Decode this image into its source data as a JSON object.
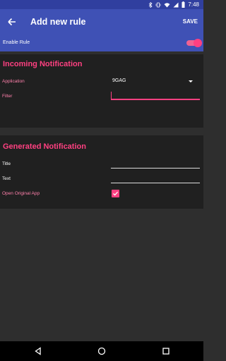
{
  "status_bar": {
    "time": "7:48",
    "icons": [
      "bluetooth-icon",
      "vibrate-icon",
      "wifi-icon",
      "signal-icon",
      "battery-icon"
    ]
  },
  "app_bar": {
    "title": "Add new rule",
    "save_label": "SAVE",
    "back_icon": "arrow-back-icon"
  },
  "enable_rule": {
    "label": "Enable Rule",
    "enabled": true
  },
  "incoming": {
    "title": "Incoming Notification",
    "application_label": "Application",
    "application_value": "9GAG",
    "filter_label": "Filter",
    "filter_value": ""
  },
  "generated": {
    "title": "Generated Notification",
    "title_label": "Title",
    "title_value": "",
    "text_label": "Text",
    "text_value": "",
    "open_app_label": "Open Original App",
    "open_app_checked": true
  },
  "colors": {
    "primary": "#3f51b5",
    "primary_dark": "#303f9f",
    "accent": "#ff4081",
    "background": "#2e2e2e",
    "section": "#202020"
  },
  "nav_bar": {
    "icons": [
      "back-triangle-icon",
      "home-circle-icon",
      "recents-square-icon"
    ]
  }
}
